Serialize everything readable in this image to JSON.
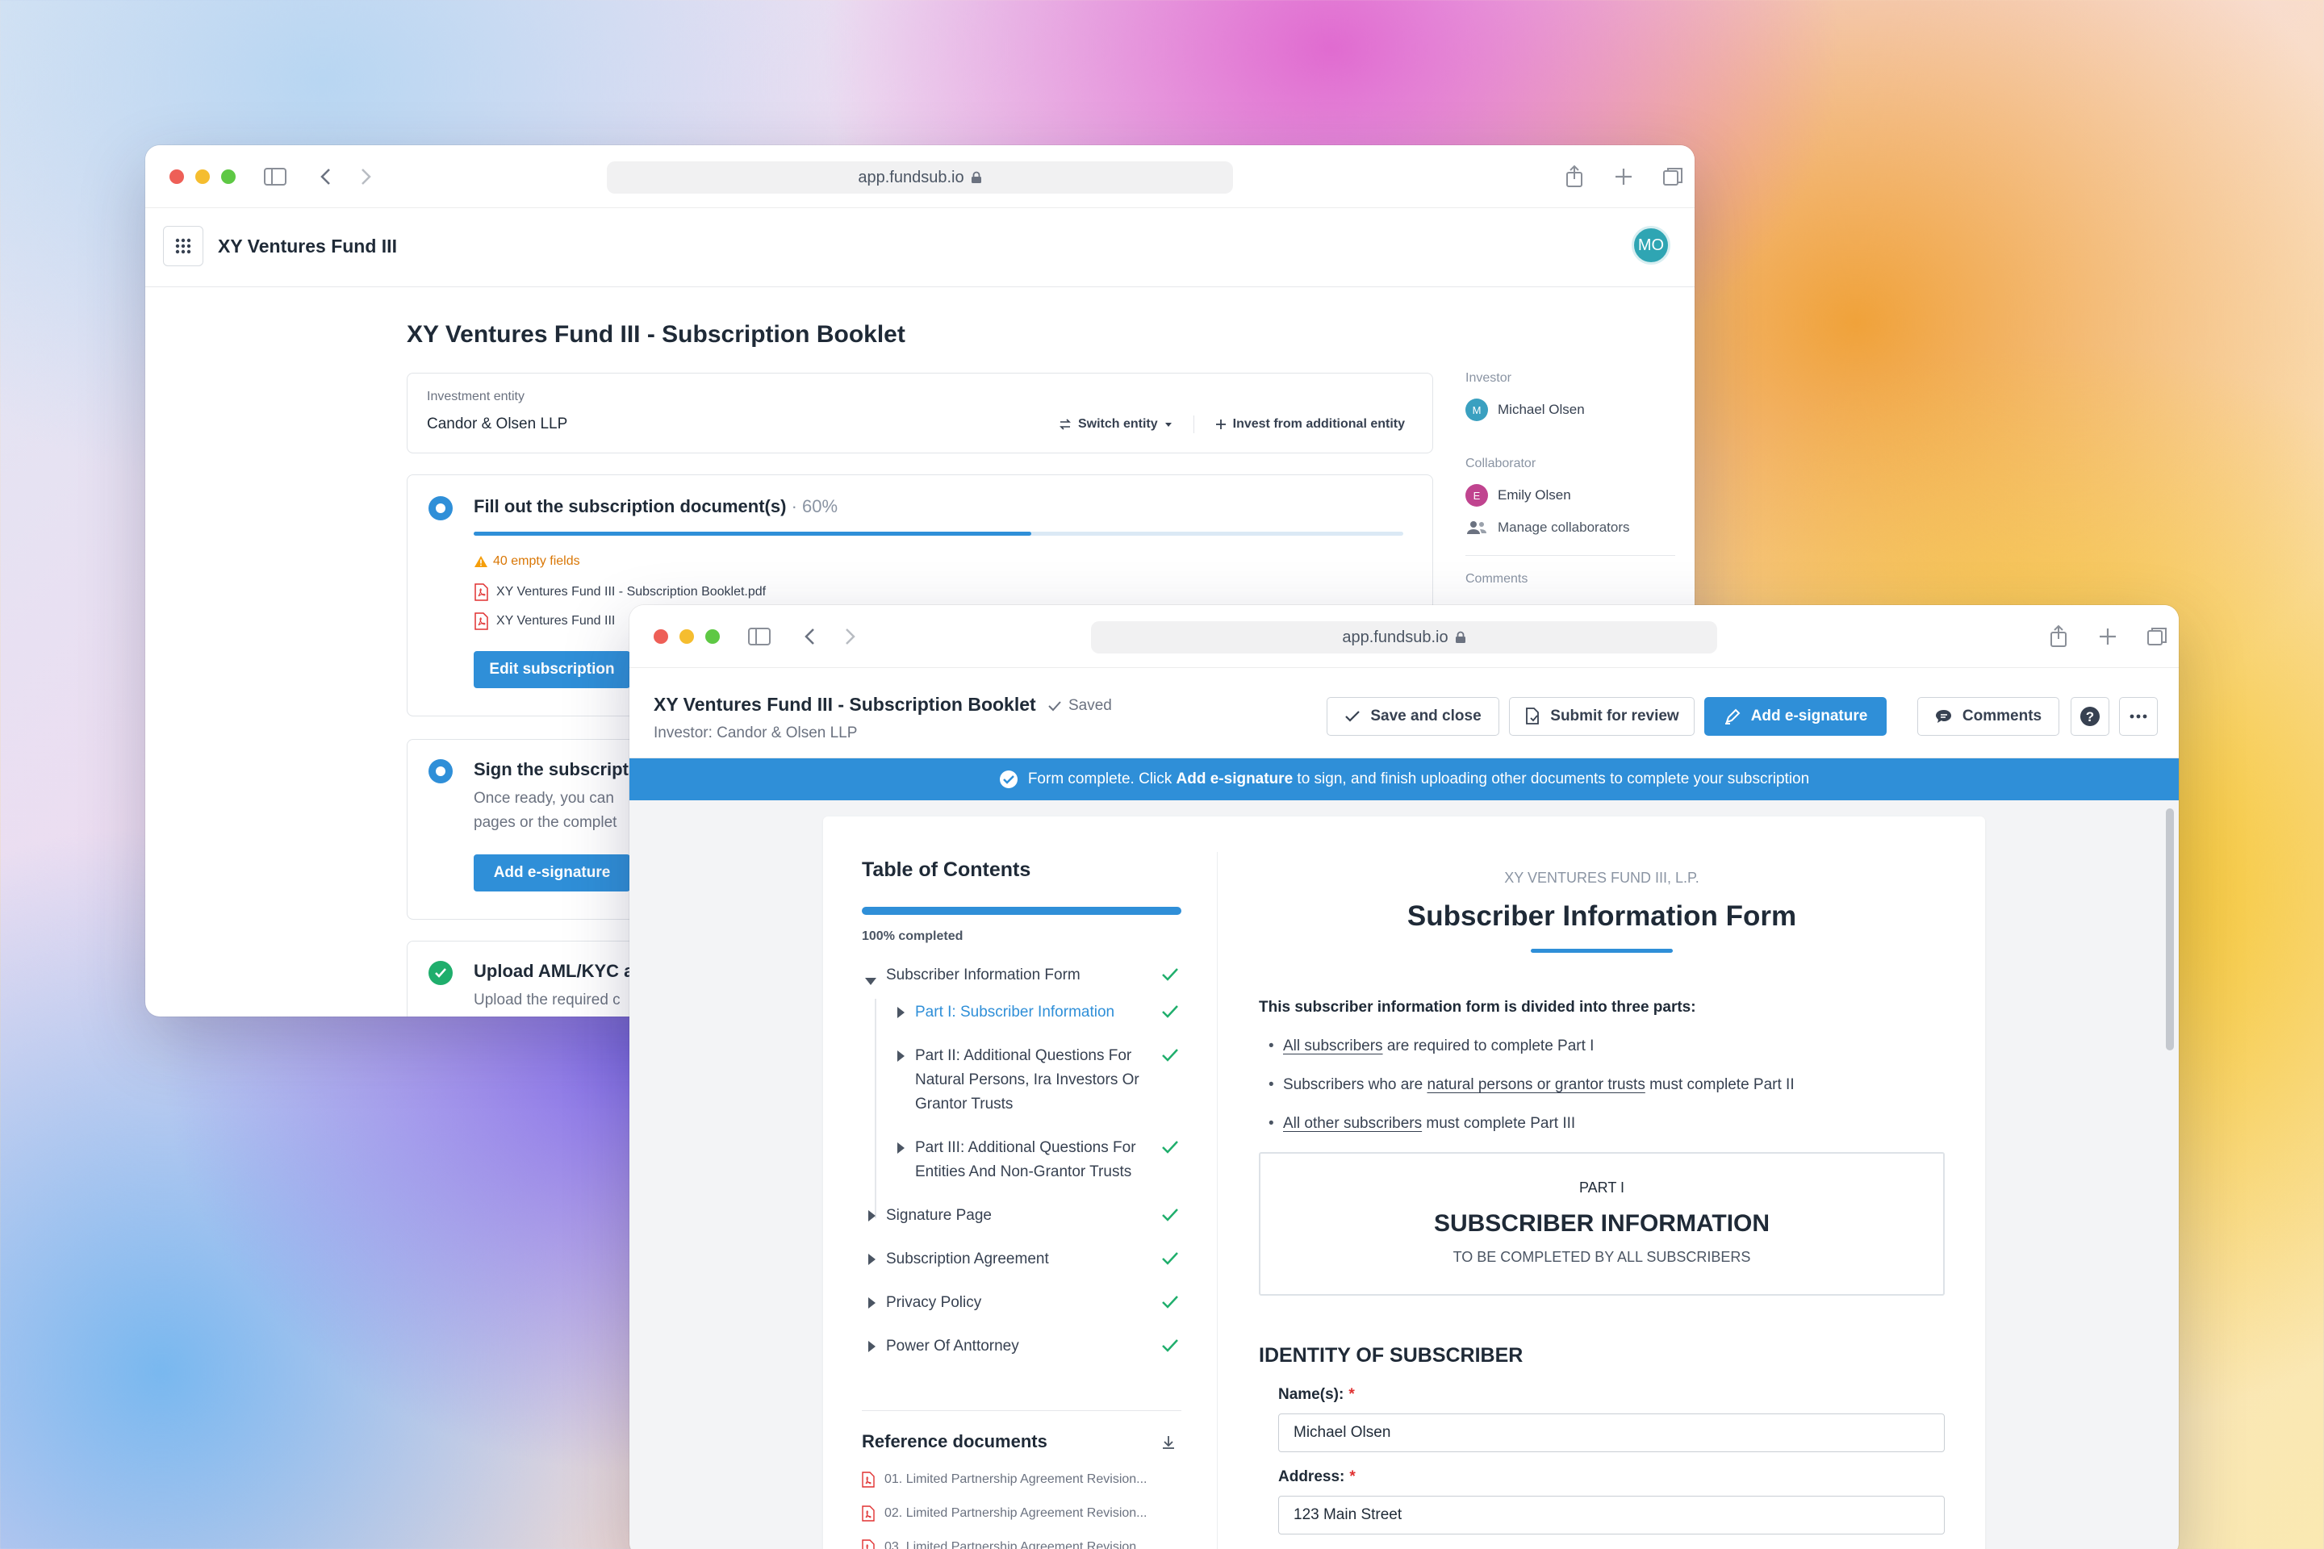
{
  "browser": {
    "url": "app.fundsub.io"
  },
  "back_window": {
    "app_title": "XY Ventures Fund III",
    "avatar_initials": "MO",
    "page_title": "XY Ventures Fund III - Subscription Booklet",
    "investment_entity": {
      "label": "Investment entity",
      "name": "Candor & Olsen LLP",
      "switch_label": "Switch entity",
      "invest_label": "Invest from additional entity"
    },
    "fill_step": {
      "title": "Fill out the subscription document(s)",
      "percent_text": "· 60%",
      "progress": 0.6,
      "warning": "40 empty fields",
      "files": [
        "XY Ventures Fund III - Subscription Booklet.pdf",
        "XY Ventures Fund III"
      ],
      "button": "Edit subscription"
    },
    "sign_step": {
      "title": "Sign the subscript",
      "desc_line1": "Once ready, you can",
      "desc_line2": "pages or the complet",
      "button": "Add e-signature"
    },
    "upload_step": {
      "title": "Upload AML/KYC a",
      "desc": "Upload the required c"
    },
    "side": {
      "investor_label": "Investor",
      "investor": {
        "initial": "M",
        "name": "Michael Olsen",
        "color": "#3aa0c0"
      },
      "collaborator_label": "Collaborator",
      "collaborator": {
        "initial": "E",
        "name": "Emily Olsen",
        "color": "#c0448f"
      },
      "manage_label": "Manage collaborators",
      "comments_label": "Comments"
    }
  },
  "front_window": {
    "doc_title": "XY Ventures Fund III - Subscription Booklet",
    "saved_label": "Saved",
    "investor_line": "Investor: Candor & Olsen LLP",
    "buttons": {
      "save_close": "Save and close",
      "submit_review": "Submit for review",
      "add_esig": "Add e-signature",
      "comments": "Comments"
    },
    "banner": {
      "prefix": "Form complete. Click",
      "bold": "Add e-signature",
      "suffix": "to sign, and finish uploading other documents to complete your subscription"
    },
    "toc": {
      "title": "Table of Contents",
      "progress_label": "100% completed",
      "items": [
        {
          "label": "Subscriber Information Form"
        },
        {
          "label": "Part I: Subscriber Information"
        },
        {
          "label_l1": "Part II: Additional Questions For",
          "label_l2": "Natural Persons, Ira Investors Or",
          "label_l3": "Grantor Trusts"
        },
        {
          "label_l1": "Part III: Additional Questions For",
          "label_l2": "Entities And Non-Grantor Trusts"
        },
        {
          "label": "Signature Page"
        },
        {
          "label": "Subscription Agreement"
        },
        {
          "label": "Privacy Policy"
        },
        {
          "label": "Power Of Anttorney"
        }
      ],
      "ref_title": "Reference documents",
      "refs": [
        "01. Limited Partnership Agreement Revision...",
        "02. Limited Partnership Agreement Revision...",
        "03. Limited Partnership Agreement Revision..."
      ]
    },
    "form": {
      "fund_name": "XY VENTURES FUND III, L.P.",
      "title": "Subscriber Information Form",
      "intro": "This subscriber information form is divided into three parts:",
      "b1_link": "All subscribers",
      "b1_rest": " are required to complete Part I",
      "b2_pre": "Subscribers who are ",
      "b2_link": "natural persons or grantor trusts",
      "b2_rest": " must complete Part II",
      "b3_link": "All other subscribers",
      "b3_rest": " must complete Part III",
      "part_label": "PART I",
      "part_title": "SUBSCRIBER INFORMATION",
      "part_sub": "TO BE COMPLETED BY ALL SUBSCRIBERS",
      "section": "IDENTITY OF SUBSCRIBER",
      "name_label": "Name(s):",
      "name_value": "Michael Olsen",
      "address_label": "Address:",
      "address_value": "123 Main Street",
      "required_mark": "*"
    }
  }
}
